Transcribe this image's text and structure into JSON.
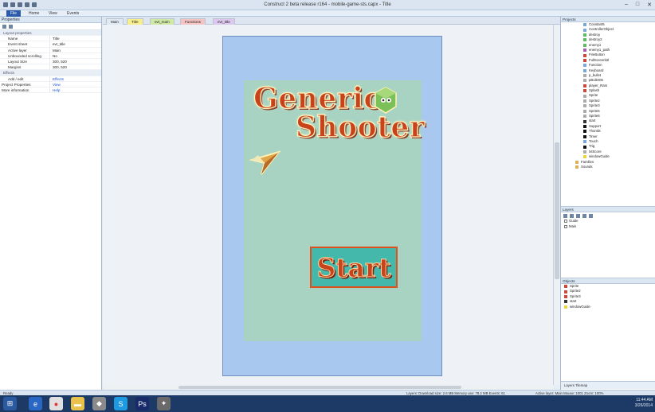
{
  "window": {
    "title": "Construct 2 beta release r164 - mobile-game-sts.capx - Title"
  },
  "ribbon": {
    "tabs": [
      "File",
      "Home",
      "View",
      "Events"
    ]
  },
  "properties": {
    "header": "Properties",
    "rows": [
      {
        "k": "Layout properties",
        "section": true
      },
      {
        "k": "Name",
        "v": "Title"
      },
      {
        "k": "Event sheet",
        "v": "evt_title"
      },
      {
        "k": "Active layer",
        "v": "Main"
      },
      {
        "k": "Unbounded scrolling",
        "v": "No"
      },
      {
        "k": "Layout Size",
        "v": "300, 520"
      },
      {
        "k": "Margins",
        "v": "300, 520"
      },
      {
        "k": "Effects",
        "section": true
      },
      {
        "k": "Add / edit",
        "v": "Effects",
        "link": true
      },
      {
        "k": "Project Properties",
        "v": "View",
        "link": true,
        "top": true
      },
      {
        "k": "More information",
        "v": "Help",
        "link": true,
        "top": true
      }
    ]
  },
  "editor": {
    "tabs": [
      {
        "label": "Main",
        "bg": "#dfe8f3"
      },
      {
        "label": "Title",
        "bg": "#f7ee8e"
      },
      {
        "label": "evt_main",
        "bg": "#cfe8a6"
      },
      {
        "label": "Functions",
        "bg": "#f4c4c4"
      },
      {
        "label": "evt_title",
        "bg": "#dcc8ee"
      }
    ]
  },
  "game": {
    "title1": "Generic",
    "title2": "Shooter",
    "start": "Start"
  },
  "projects": {
    "header": "Projects",
    "items": [
      {
        "label": "Constant5",
        "color": "#7aa6d8"
      },
      {
        "label": "ControllerObject",
        "color": "#7aa6d8"
      },
      {
        "label": "destroy",
        "color": "#5dbb63"
      },
      {
        "label": "destroy2",
        "color": "#5dbb63"
      },
      {
        "label": "enemy1",
        "color": "#5dbb63"
      },
      {
        "label": "enemy1_path",
        "color": "#a45ab0"
      },
      {
        "label": "FireButton",
        "color": "#c94a3b"
      },
      {
        "label": "FullScreenbtl",
        "color": "#c94a3b"
      },
      {
        "label": "Function",
        "color": "#7aa6d8"
      },
      {
        "label": "Keyboard",
        "color": "#7aa6d8"
      },
      {
        "label": "p_bullet",
        "color": "#aaaaaa"
      },
      {
        "label": "pBullet06",
        "color": "#aaaaaa"
      },
      {
        "label": "player_Ram",
        "color": "#c94a3b"
      },
      {
        "label": "Splash",
        "color": "#c94a3b"
      },
      {
        "label": "Sprite",
        "color": "#aaaaaa"
      },
      {
        "label": "Sprite2",
        "color": "#aaaaaa"
      },
      {
        "label": "Sprite3",
        "color": "#aaaaaa"
      },
      {
        "label": "Sprite5",
        "color": "#aaaaaa"
      },
      {
        "label": "Sprite6",
        "color": "#aaaaaa"
      },
      {
        "label": "start",
        "color": "#333333"
      },
      {
        "label": "Support",
        "color": "#111111"
      },
      {
        "label": "Thumbt",
        "color": "#111111"
      },
      {
        "label": "Timer",
        "color": "#111111"
      },
      {
        "label": "Touch",
        "color": "#7aa6d8"
      },
      {
        "label": "Trig",
        "color": "#111111"
      },
      {
        "label": "txtScore",
        "color": "#aaaaaa"
      },
      {
        "label": "windowGuide",
        "color": "#e8d640"
      },
      {
        "label": "Families",
        "color": "#d9b25a"
      },
      {
        "label": "Sounds",
        "color": "#d9b25a"
      }
    ]
  },
  "layers": {
    "header": "Layers",
    "items": [
      "Guide",
      "Main"
    ]
  },
  "objects": {
    "header": "Objects",
    "items": [
      {
        "label": "Sprite",
        "color": "#c94a3b"
      },
      {
        "label": "Sprite2",
        "color": "#c94a3b"
      },
      {
        "label": "Sprite3",
        "color": "#c94a3b"
      },
      {
        "label": "start",
        "color": "#333333"
      },
      {
        "label": "windowGuide",
        "color": "#e8d640"
      }
    ]
  },
  "panelTabs": "Layers   Tilemap",
  "status": {
    "left": "Ready",
    "middle": "Layers: Download size: 2.6 MB   Memory use: 78.2 MB   Events: 61",
    "right": "Active layer: Main   Mouse: 1001  Zoom: 100%"
  },
  "tray": {
    "time": "11:44 AM",
    "date": "3/26/2014"
  }
}
